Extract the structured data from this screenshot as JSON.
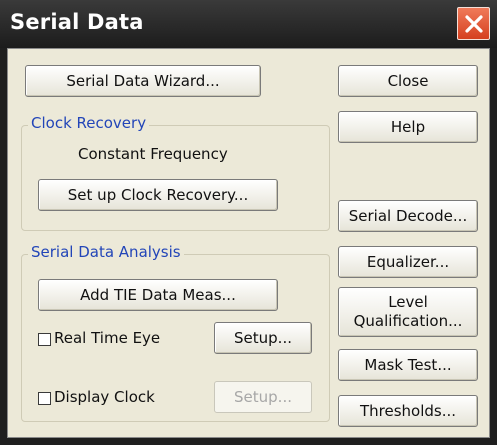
{
  "window": {
    "title": "Serial Data"
  },
  "buttons": {
    "wizard": "Serial Data Wizard...",
    "close": "Close",
    "help": "Help",
    "serial_decode": "Serial Decode...",
    "equalizer": "Equalizer...",
    "level_qualification": "Level\nQualification...",
    "mask_test": "Mask Test...",
    "thresholds": "Thresholds...",
    "setup_clock_recovery": "Set up Clock Recovery...",
    "add_tie": "Add TIE Data Meas...",
    "real_time_eye_setup": "Setup...",
    "display_clock_setup": "Setup..."
  },
  "clock_recovery": {
    "label": "Clock Recovery",
    "mode": "Constant Frequency"
  },
  "analysis": {
    "label": "Serial Data Analysis",
    "real_time_eye": "Real Time Eye",
    "display_clock": "Display Clock"
  },
  "checkboxes": {
    "real_time_eye_checked": false,
    "display_clock_checked": false
  },
  "colors": {
    "title_bar": "#1c1c1c",
    "close_button": "#d5401f",
    "dialog_background": "#ece9d8",
    "group_label": "#2245b8"
  },
  "icons": {
    "close": "close-x-icon"
  }
}
